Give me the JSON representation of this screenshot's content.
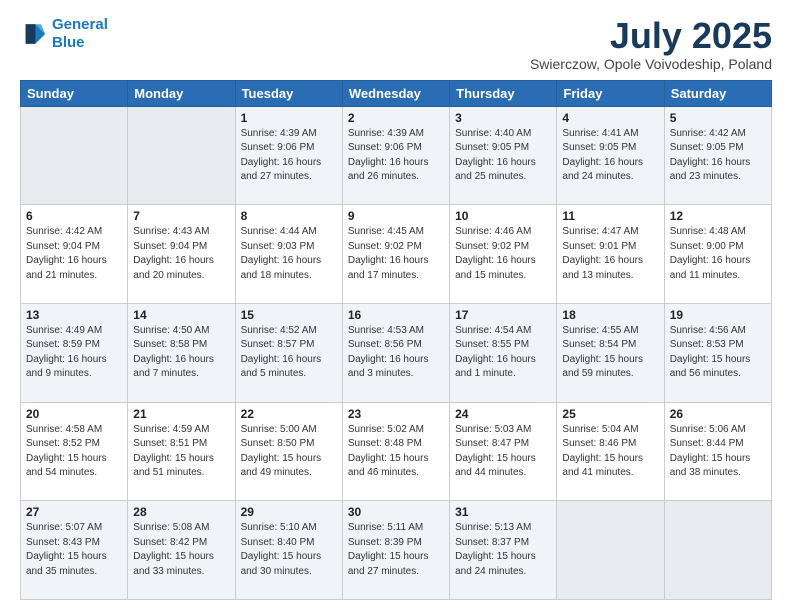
{
  "header": {
    "logo_line1": "General",
    "logo_line2": "Blue",
    "month_title": "July 2025",
    "subtitle": "Swierczow, Opole Voivodeship, Poland"
  },
  "days_of_week": [
    "Sunday",
    "Monday",
    "Tuesday",
    "Wednesday",
    "Thursday",
    "Friday",
    "Saturday"
  ],
  "weeks": [
    [
      {
        "day": "",
        "detail": ""
      },
      {
        "day": "",
        "detail": ""
      },
      {
        "day": "1",
        "detail": "Sunrise: 4:39 AM\nSunset: 9:06 PM\nDaylight: 16 hours\nand 27 minutes."
      },
      {
        "day": "2",
        "detail": "Sunrise: 4:39 AM\nSunset: 9:06 PM\nDaylight: 16 hours\nand 26 minutes."
      },
      {
        "day": "3",
        "detail": "Sunrise: 4:40 AM\nSunset: 9:05 PM\nDaylight: 16 hours\nand 25 minutes."
      },
      {
        "day": "4",
        "detail": "Sunrise: 4:41 AM\nSunset: 9:05 PM\nDaylight: 16 hours\nand 24 minutes."
      },
      {
        "day": "5",
        "detail": "Sunrise: 4:42 AM\nSunset: 9:05 PM\nDaylight: 16 hours\nand 23 minutes."
      }
    ],
    [
      {
        "day": "6",
        "detail": "Sunrise: 4:42 AM\nSunset: 9:04 PM\nDaylight: 16 hours\nand 21 minutes."
      },
      {
        "day": "7",
        "detail": "Sunrise: 4:43 AM\nSunset: 9:04 PM\nDaylight: 16 hours\nand 20 minutes."
      },
      {
        "day": "8",
        "detail": "Sunrise: 4:44 AM\nSunset: 9:03 PM\nDaylight: 16 hours\nand 18 minutes."
      },
      {
        "day": "9",
        "detail": "Sunrise: 4:45 AM\nSunset: 9:02 PM\nDaylight: 16 hours\nand 17 minutes."
      },
      {
        "day": "10",
        "detail": "Sunrise: 4:46 AM\nSunset: 9:02 PM\nDaylight: 16 hours\nand 15 minutes."
      },
      {
        "day": "11",
        "detail": "Sunrise: 4:47 AM\nSunset: 9:01 PM\nDaylight: 16 hours\nand 13 minutes."
      },
      {
        "day": "12",
        "detail": "Sunrise: 4:48 AM\nSunset: 9:00 PM\nDaylight: 16 hours\nand 11 minutes."
      }
    ],
    [
      {
        "day": "13",
        "detail": "Sunrise: 4:49 AM\nSunset: 8:59 PM\nDaylight: 16 hours\nand 9 minutes."
      },
      {
        "day": "14",
        "detail": "Sunrise: 4:50 AM\nSunset: 8:58 PM\nDaylight: 16 hours\nand 7 minutes."
      },
      {
        "day": "15",
        "detail": "Sunrise: 4:52 AM\nSunset: 8:57 PM\nDaylight: 16 hours\nand 5 minutes."
      },
      {
        "day": "16",
        "detail": "Sunrise: 4:53 AM\nSunset: 8:56 PM\nDaylight: 16 hours\nand 3 minutes."
      },
      {
        "day": "17",
        "detail": "Sunrise: 4:54 AM\nSunset: 8:55 PM\nDaylight: 16 hours\nand 1 minute."
      },
      {
        "day": "18",
        "detail": "Sunrise: 4:55 AM\nSunset: 8:54 PM\nDaylight: 15 hours\nand 59 minutes."
      },
      {
        "day": "19",
        "detail": "Sunrise: 4:56 AM\nSunset: 8:53 PM\nDaylight: 15 hours\nand 56 minutes."
      }
    ],
    [
      {
        "day": "20",
        "detail": "Sunrise: 4:58 AM\nSunset: 8:52 PM\nDaylight: 15 hours\nand 54 minutes."
      },
      {
        "day": "21",
        "detail": "Sunrise: 4:59 AM\nSunset: 8:51 PM\nDaylight: 15 hours\nand 51 minutes."
      },
      {
        "day": "22",
        "detail": "Sunrise: 5:00 AM\nSunset: 8:50 PM\nDaylight: 15 hours\nand 49 minutes."
      },
      {
        "day": "23",
        "detail": "Sunrise: 5:02 AM\nSunset: 8:48 PM\nDaylight: 15 hours\nand 46 minutes."
      },
      {
        "day": "24",
        "detail": "Sunrise: 5:03 AM\nSunset: 8:47 PM\nDaylight: 15 hours\nand 44 minutes."
      },
      {
        "day": "25",
        "detail": "Sunrise: 5:04 AM\nSunset: 8:46 PM\nDaylight: 15 hours\nand 41 minutes."
      },
      {
        "day": "26",
        "detail": "Sunrise: 5:06 AM\nSunset: 8:44 PM\nDaylight: 15 hours\nand 38 minutes."
      }
    ],
    [
      {
        "day": "27",
        "detail": "Sunrise: 5:07 AM\nSunset: 8:43 PM\nDaylight: 15 hours\nand 35 minutes."
      },
      {
        "day": "28",
        "detail": "Sunrise: 5:08 AM\nSunset: 8:42 PM\nDaylight: 15 hours\nand 33 minutes."
      },
      {
        "day": "29",
        "detail": "Sunrise: 5:10 AM\nSunset: 8:40 PM\nDaylight: 15 hours\nand 30 minutes."
      },
      {
        "day": "30",
        "detail": "Sunrise: 5:11 AM\nSunset: 8:39 PM\nDaylight: 15 hours\nand 27 minutes."
      },
      {
        "day": "31",
        "detail": "Sunrise: 5:13 AM\nSunset: 8:37 PM\nDaylight: 15 hours\nand 24 minutes."
      },
      {
        "day": "",
        "detail": ""
      },
      {
        "day": "",
        "detail": ""
      }
    ]
  ]
}
